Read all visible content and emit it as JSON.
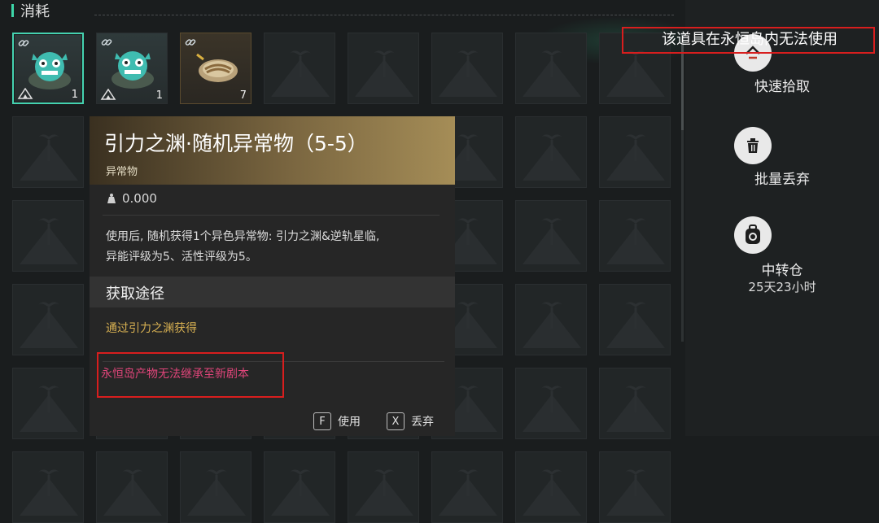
{
  "header": {
    "title": "消耗"
  },
  "slots": [
    {
      "quantity": "1",
      "item": "anomaly-creature-icon",
      "selected": true
    },
    {
      "quantity": "1",
      "item": "anomaly-creature-icon",
      "selected": false
    },
    {
      "quantity": "7",
      "item": "sardine-can-icon",
      "selected": false
    }
  ],
  "tooltip": {
    "name": "引力之渊·随机异常物（5-5）",
    "type": "异常物",
    "weight": "0.000",
    "description_line1": "使用后, 随机获得1个异色异常物: 引力之渊&逆轨星临,",
    "description_line2": "异能评级为5、活性评级为5。",
    "section_title": "获取途径",
    "source": "通过引力之渊获得",
    "warning": "永恒岛产物无法继承至新剧本",
    "colors": {
      "source": "#d7b052",
      "warning": "#e0457a"
    }
  },
  "hints": [
    {
      "key": "F",
      "label": "使用"
    },
    {
      "key": "X",
      "label": "丢弃"
    }
  ],
  "side": {
    "quick_pickup": "快速拾取",
    "bulk_discard": "批量丢弃",
    "transfer_storage": "中转仓",
    "transfer_timer": "25天23小时"
  },
  "notice": {
    "text": "该道具在永恒岛内无法使用"
  }
}
